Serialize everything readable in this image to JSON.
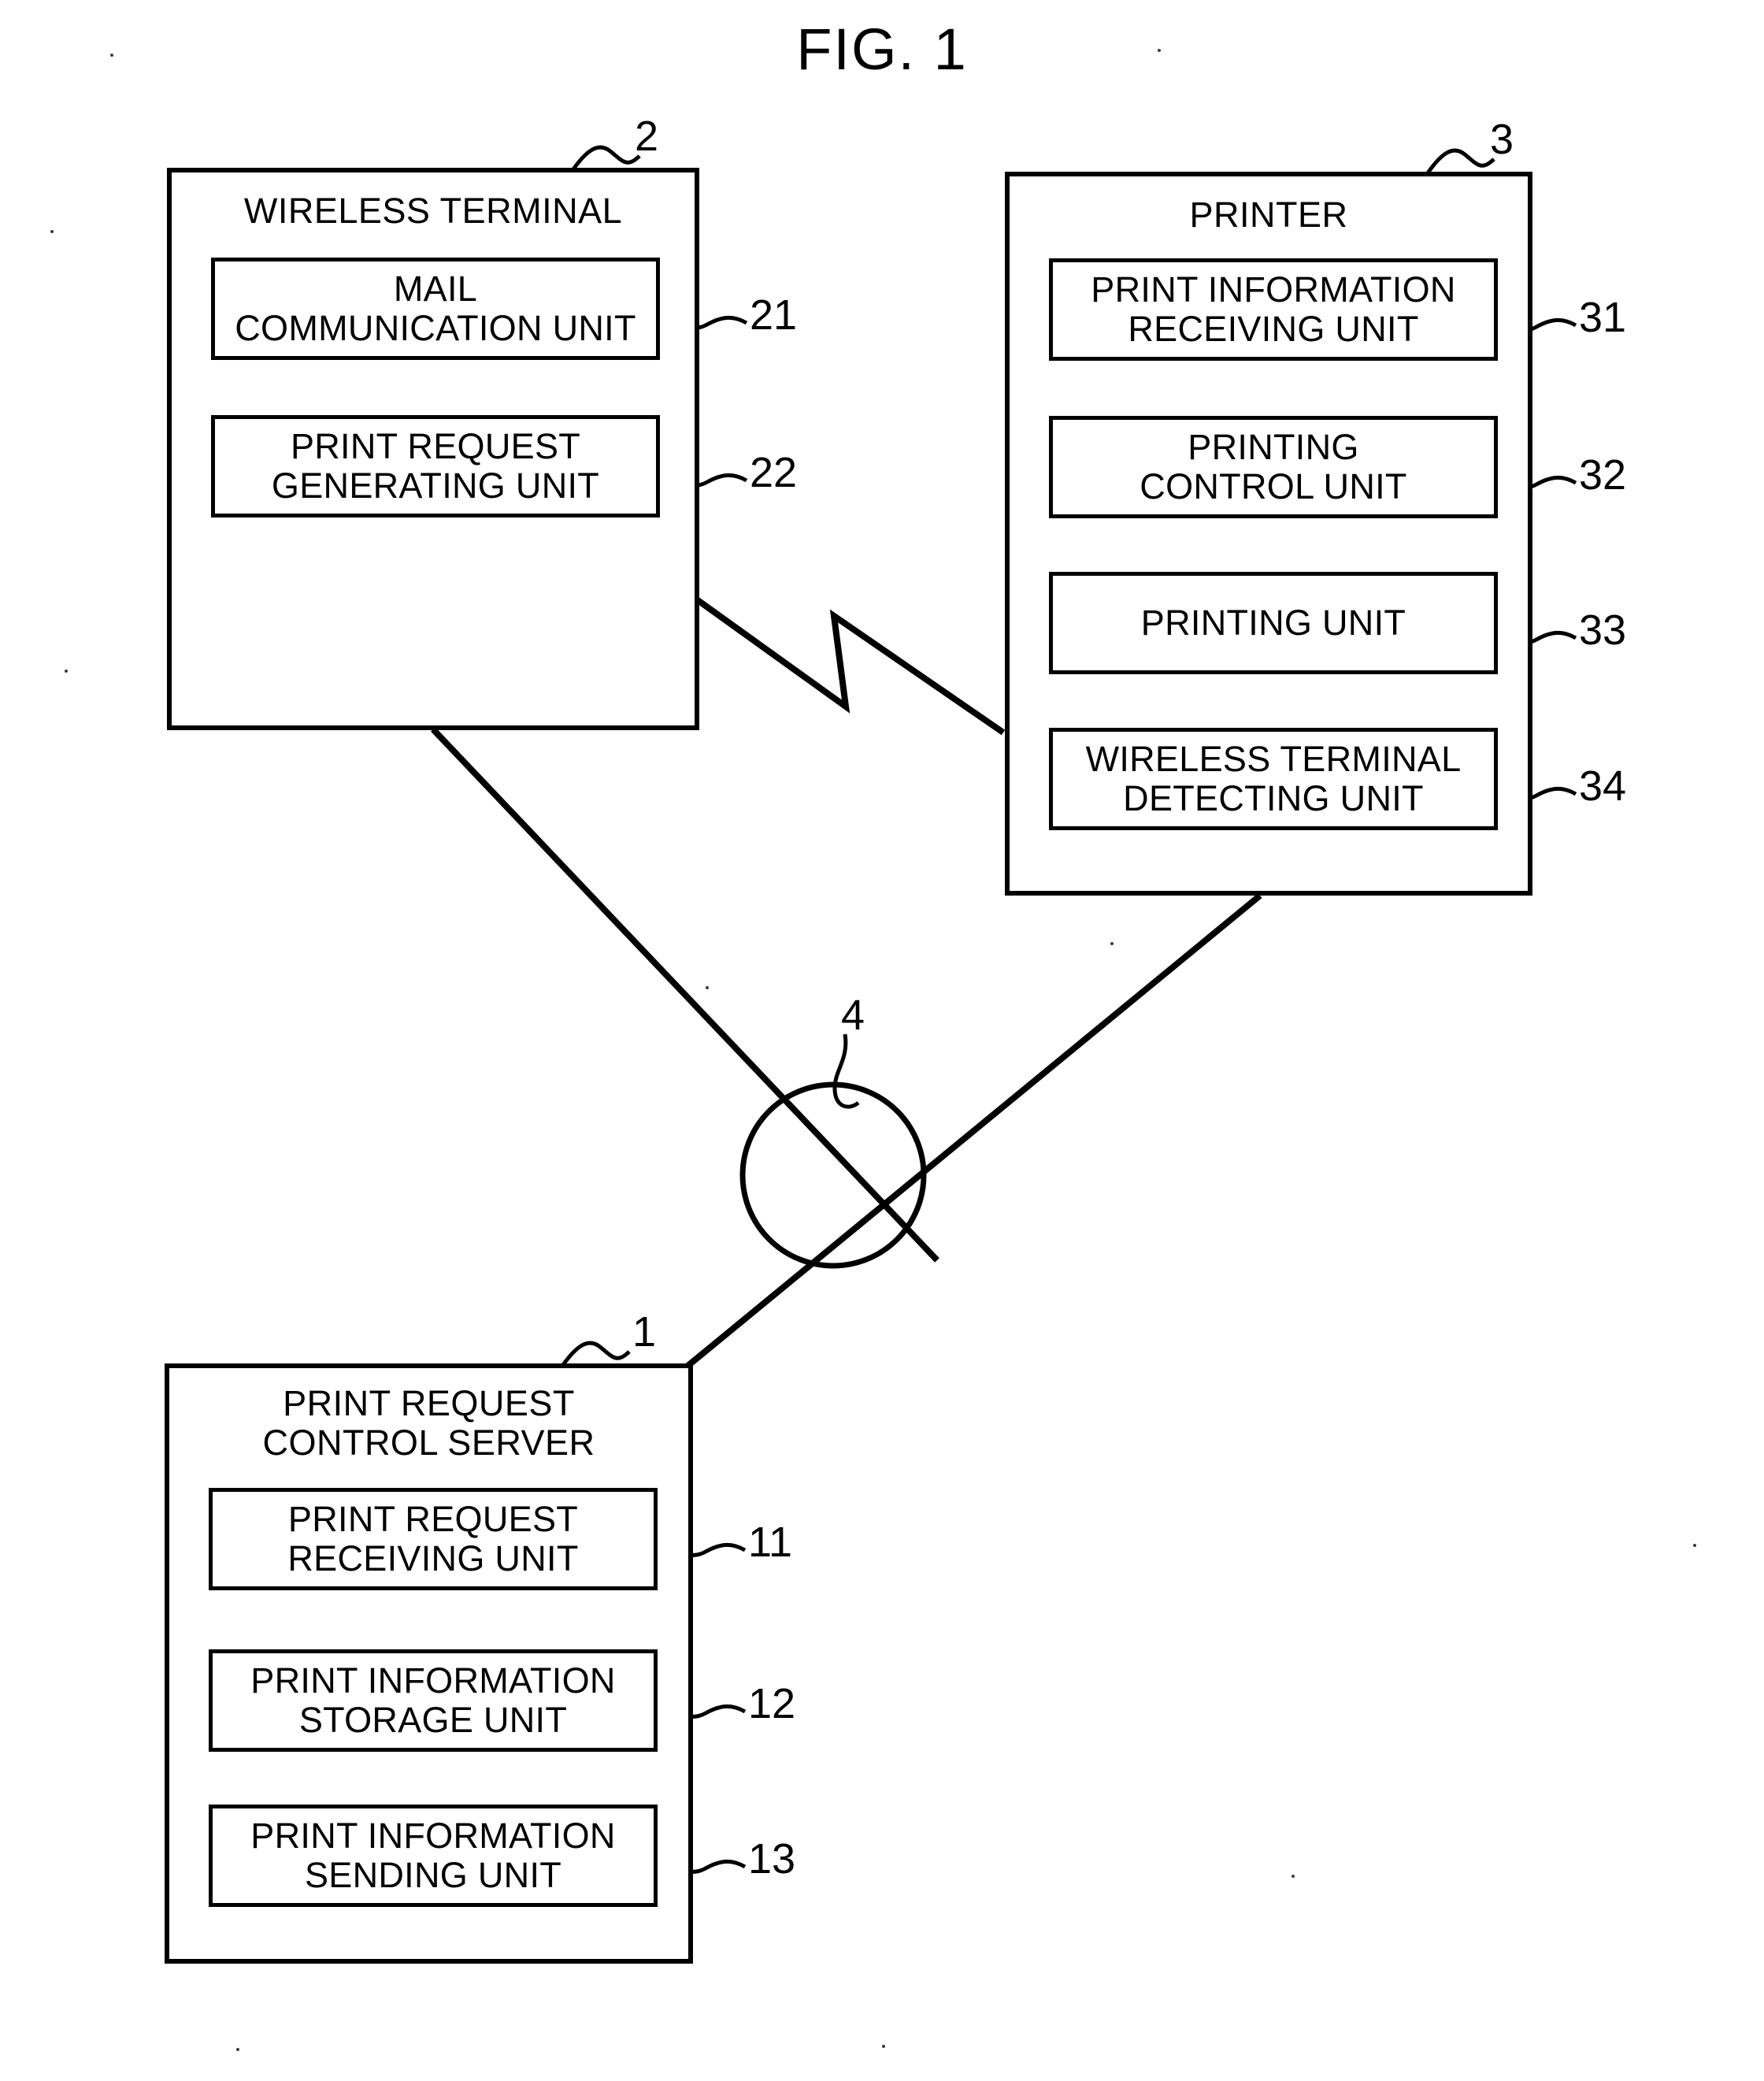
{
  "figure": {
    "title": "FIG. 1",
    "type": "patent-block-diagram"
  },
  "nodes": {
    "wireless_terminal": {
      "title": "WIRELESS TERMINAL",
      "ref": "2",
      "units": [
        {
          "label": "MAIL\nCOMMUNICATION UNIT",
          "ref": "21"
        },
        {
          "label": "PRINT REQUEST\nGENERATING UNIT",
          "ref": "22"
        }
      ]
    },
    "printer": {
      "title": "PRINTER",
      "ref": "3",
      "units": [
        {
          "label": "PRINT INFORMATION\nRECEIVING UNIT",
          "ref": "31"
        },
        {
          "label": "PRINTING\nCONTROL UNIT",
          "ref": "32"
        },
        {
          "label": "PRINTING UNIT",
          "ref": "33"
        },
        {
          "label": "WIRELESS TERMINAL\nDETECTING UNIT",
          "ref": "34"
        }
      ]
    },
    "control_server": {
      "title": "PRINT REQUEST\nCONTROL SERVER",
      "ref": "1",
      "units": [
        {
          "label": "PRINT REQUEST\nRECEIVING UNIT",
          "ref": "11"
        },
        {
          "label": "PRINT INFORMATION\nSTORAGE UNIT",
          "ref": "12"
        },
        {
          "label": "PRINT INFORMATION\nSENDING UNIT",
          "ref": "13"
        }
      ]
    },
    "network": {
      "ref": "4",
      "symbol": "network-circle-cross-icon"
    }
  },
  "connections": [
    {
      "from": "wireless_terminal",
      "to": "printer",
      "style": "wireless-lightning"
    },
    {
      "from": "wireless_terminal",
      "to": "network",
      "style": "line"
    },
    {
      "from": "printer",
      "to": "network",
      "style": "line"
    },
    {
      "from": "network",
      "to": "control_server",
      "style": "line"
    }
  ],
  "colors": {
    "ink": "#000000",
    "paper": "#ffffff"
  }
}
